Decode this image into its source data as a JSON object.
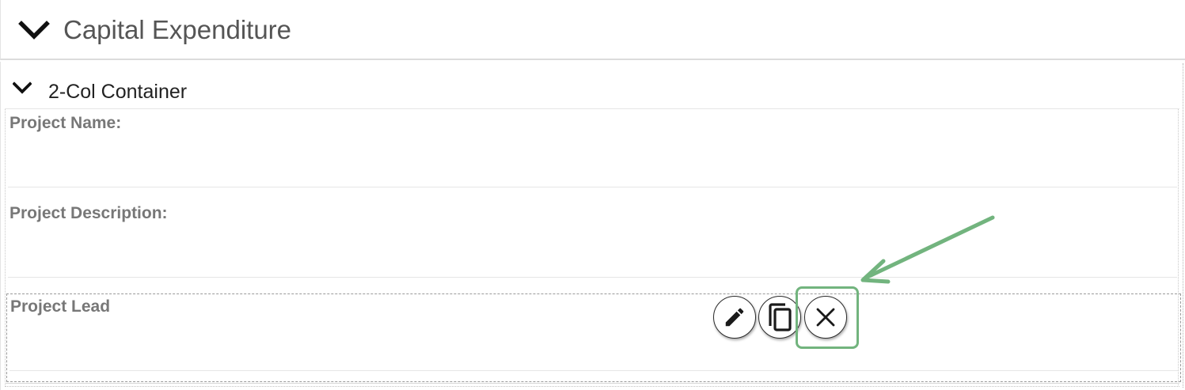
{
  "section": {
    "title": "Capital Expenditure",
    "icon": "chevron-down-icon"
  },
  "container": {
    "title": "2-Col Container",
    "icon": "chevron-down-icon"
  },
  "fields": {
    "project_name": "Project Name:",
    "project_description": "Project Description:",
    "project_lead": "Project Lead"
  },
  "actions": [
    {
      "name": "edit",
      "icon": "pencil-icon"
    },
    {
      "name": "copy",
      "icon": "copy-icon"
    },
    {
      "name": "delete",
      "icon": "close-icon"
    }
  ],
  "colors": {
    "highlight": "#72b47e",
    "label_text": "#777777",
    "title_text": "#555555"
  }
}
